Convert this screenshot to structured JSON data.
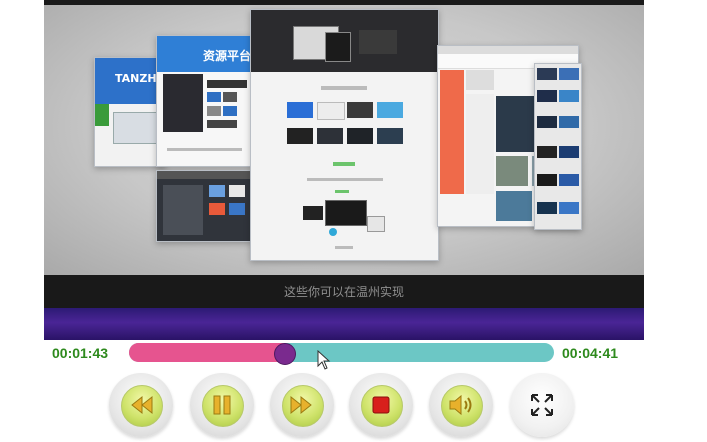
{
  "video": {
    "subtitle": "这些你可以在温州实现",
    "screen_brand_cn": "资源平台",
    "screen_brand_en": "TANZHO",
    "screen_title": "资源平台"
  },
  "player": {
    "current_time": "00:01:43",
    "total_time": "00:04:41",
    "progress_fraction": 0.366
  },
  "controls": {
    "buttons": [
      {
        "name": "rewind-button",
        "icon": "rewind-icon"
      },
      {
        "name": "pause-button",
        "icon": "pause-icon"
      },
      {
        "name": "fast-forward-button",
        "icon": "fast-forward-icon"
      },
      {
        "name": "stop-button",
        "icon": "stop-icon"
      },
      {
        "name": "volume-button",
        "icon": "volume-icon"
      },
      {
        "name": "fullscreen-button",
        "icon": "fullscreen-icon"
      }
    ]
  },
  "colors": {
    "time_text": "#2e8a1d",
    "progress_played": "#e6548f",
    "progress_remaining": "#6cc7c5",
    "thumb": "#7a2a8e",
    "button_accent": "#cfe36b",
    "button_icon": "#e7b12c",
    "stop_icon": "#d8201c"
  }
}
